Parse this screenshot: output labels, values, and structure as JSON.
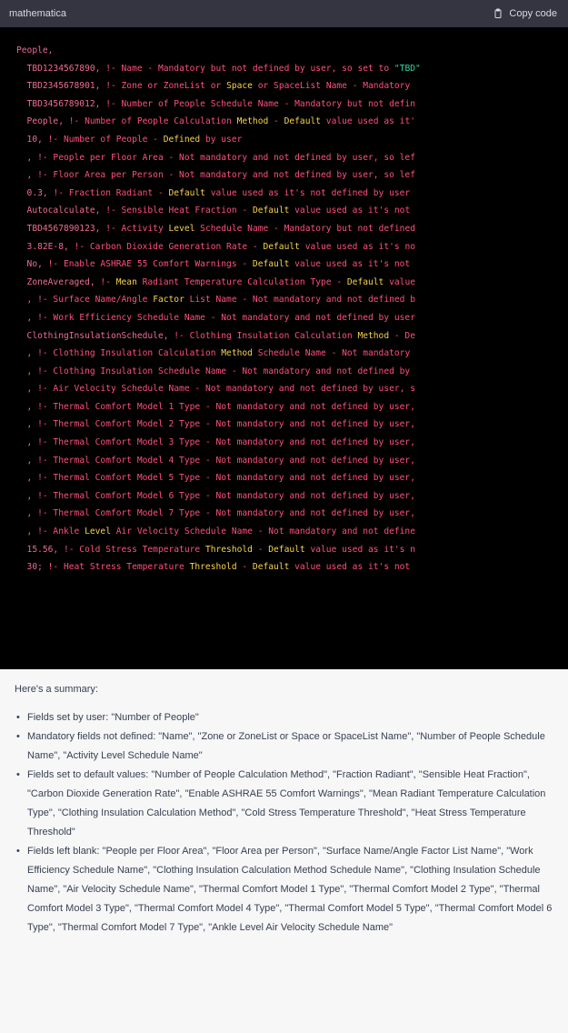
{
  "header": {
    "language": "mathematica",
    "copy_label": "Copy code"
  },
  "code_lines": [
    [
      [
        "lit",
        "People,"
      ]
    ],
    [
      [
        "lit",
        "  TBD1234567890, "
      ],
      [
        "cm",
        "!- Name - Mandatory but not defined by user, so set to "
      ],
      [
        "str",
        "\"TBD\""
      ]
    ],
    [
      [
        "lit",
        "  TBD2345678901, "
      ],
      [
        "cm",
        "!- Zone or ZoneList or "
      ],
      [
        "kw",
        "Space"
      ],
      [
        "cm",
        " or SpaceList Name - Mandatory"
      ]
    ],
    [
      [
        "lit",
        "  TBD3456789012, "
      ],
      [
        "cm",
        "!- Number of People Schedule Name - Mandatory but not defin"
      ]
    ],
    [
      [
        "lit",
        "  People, "
      ],
      [
        "cm",
        "!- Number of People Calculation "
      ],
      [
        "kw",
        "Method"
      ],
      [
        "cm",
        " - "
      ],
      [
        "kw",
        "Default"
      ],
      [
        "cm",
        " value used as it'"
      ]
    ],
    [
      [
        "lit",
        "  10, "
      ],
      [
        "cm",
        "!- Number of People - "
      ],
      [
        "kw",
        "Defined"
      ],
      [
        "cm",
        " by user"
      ]
    ],
    [
      [
        "lit",
        "  , "
      ],
      [
        "cm",
        "!- People per Floor Area - Not mandatory and not defined by user, so lef"
      ]
    ],
    [
      [
        "lit",
        "  , "
      ],
      [
        "cm",
        "!- Floor Area per Person - Not mandatory and not defined by user, so lef"
      ]
    ],
    [
      [
        "lit",
        "  0.3, "
      ],
      [
        "cm",
        "!- Fraction Radiant - "
      ],
      [
        "kw",
        "Default"
      ],
      [
        "cm",
        " value used as it's not defined by user"
      ]
    ],
    [
      [
        "lit",
        "  Autocalculate, "
      ],
      [
        "cm",
        "!- Sensible Heat Fraction - "
      ],
      [
        "kw",
        "Default"
      ],
      [
        "cm",
        " value used as it's not"
      ]
    ],
    [
      [
        "lit",
        "  TBD4567890123, "
      ],
      [
        "cm",
        "!- Activity "
      ],
      [
        "kw",
        "Level"
      ],
      [
        "cm",
        " Schedule Name - Mandatory but not defined"
      ]
    ],
    [
      [
        "lit",
        "  3.82E-8, "
      ],
      [
        "cm",
        "!- Carbon Dioxide Generation Rate - "
      ],
      [
        "kw",
        "Default"
      ],
      [
        "cm",
        " value used as it's no"
      ]
    ],
    [
      [
        "lit",
        "  No, "
      ],
      [
        "cm",
        "!- Enable ASHRAE 55 Comfort Warnings - "
      ],
      [
        "kw",
        "Default"
      ],
      [
        "cm",
        " value used as it's not"
      ]
    ],
    [
      [
        "lit",
        "  ZoneAveraged, "
      ],
      [
        "cm",
        "!- "
      ],
      [
        "kw",
        "Mean"
      ],
      [
        "cm",
        " Radiant Temperature Calculation Type - "
      ],
      [
        "kw",
        "Default"
      ],
      [
        "cm",
        " value"
      ]
    ],
    [
      [
        "lit",
        "  , "
      ],
      [
        "cm",
        "!- Surface Name/Angle "
      ],
      [
        "kw",
        "Factor"
      ],
      [
        "cm",
        " List Name - Not mandatory and not defined b"
      ]
    ],
    [
      [
        "lit",
        "  , "
      ],
      [
        "cm",
        "!- Work Efficiency Schedule Name - Not mandatory and not defined by user"
      ]
    ],
    [
      [
        "lit",
        "  ClothingInsulationSchedule, "
      ],
      [
        "cm",
        "!- Clothing Insulation Calculation "
      ],
      [
        "kw",
        "Method"
      ],
      [
        "cm",
        " - De"
      ]
    ],
    [
      [
        "lit",
        "  , "
      ],
      [
        "cm",
        "!- Clothing Insulation Calculation "
      ],
      [
        "kw",
        "Method"
      ],
      [
        "cm",
        " Schedule Name - Not mandatory"
      ]
    ],
    [
      [
        "lit",
        "  , "
      ],
      [
        "cm",
        "!- Clothing Insulation Schedule Name - Not mandatory and not defined by"
      ]
    ],
    [
      [
        "lit",
        "  , "
      ],
      [
        "cm",
        "!- Air Velocity Schedule Name - Not mandatory and not defined by user, s"
      ]
    ],
    [
      [
        "lit",
        "  , "
      ],
      [
        "cm",
        "!- Thermal Comfort Model 1 Type - Not mandatory and not defined by user,"
      ]
    ],
    [
      [
        "lit",
        "  , "
      ],
      [
        "cm",
        "!- Thermal Comfort Model 2 Type - Not mandatory and not defined by user,"
      ]
    ],
    [
      [
        "lit",
        "  , "
      ],
      [
        "cm",
        "!- Thermal Comfort Model 3 Type - Not mandatory and not defined by user,"
      ]
    ],
    [
      [
        "lit",
        "  , "
      ],
      [
        "cm",
        "!- Thermal Comfort Model 4 Type - Not mandatory and not defined by user,"
      ]
    ],
    [
      [
        "lit",
        "  , "
      ],
      [
        "cm",
        "!- Thermal Comfort Model 5 Type - Not mandatory and not defined by user,"
      ]
    ],
    [
      [
        "lit",
        "  , "
      ],
      [
        "cm",
        "!- Thermal Comfort Model 6 Type - Not mandatory and not defined by user,"
      ]
    ],
    [
      [
        "lit",
        "  , "
      ],
      [
        "cm",
        "!- Thermal Comfort Model 7 Type - Not mandatory and not defined by user,"
      ]
    ],
    [
      [
        "lit",
        "  , "
      ],
      [
        "cm",
        "!- Ankle "
      ],
      [
        "kw",
        "Level"
      ],
      [
        "cm",
        " Air Velocity Schedule Name - Not mandatory and not define"
      ]
    ],
    [
      [
        "lit",
        "  15.56, "
      ],
      [
        "cm",
        "!- Cold Stress Temperature "
      ],
      [
        "kw",
        "Threshold"
      ],
      [
        "cm",
        " - "
      ],
      [
        "kw",
        "Default"
      ],
      [
        "cm",
        " value used as it's n"
      ]
    ],
    [
      [
        "lit",
        "  30; "
      ],
      [
        "cm",
        "!- Heat Stress Temperature "
      ],
      [
        "kw",
        "Threshold"
      ],
      [
        "cm",
        " - "
      ],
      [
        "kw",
        "Default"
      ],
      [
        "cm",
        " value used as it's not"
      ]
    ]
  ],
  "summary": {
    "intro": "Here's a summary:",
    "items": [
      "Fields set by user: \"Number of People\"",
      "Mandatory fields not defined: \"Name\", \"Zone or ZoneList or Space or SpaceList Name\", \"Number of People Schedule Name\", \"Activity Level Schedule Name\"",
      "Fields set to default values: \"Number of People Calculation Method\", \"Fraction Radiant\", \"Sensible Heat Fraction\", \"Carbon Dioxide Generation Rate\", \"Enable ASHRAE 55 Comfort Warnings\", \"Mean Radiant Temperature Calculation Type\", \"Clothing Insulation Calculation Method\", \"Cold Stress Temperature Threshold\", \"Heat Stress Temperature Threshold\"",
      "Fields left blank: \"People per Floor Area\", \"Floor Area per Person\", \"Surface Name/Angle Factor List Name\", \"Work Efficiency Schedule Name\", \"Clothing Insulation Calculation Method Schedule Name\", \"Clothing Insulation Schedule Name\", \"Air Velocity Schedule Name\", \"Thermal Comfort Model 1 Type\", \"Thermal Comfort Model 2 Type\", \"Thermal Comfort Model 3 Type\", \"Thermal Comfort Model 4 Type\", \"Thermal Comfort Model 5 Type\", \"Thermal Comfort Model 6 Type\", \"Thermal Comfort Model 7 Type\", \"Ankle Level Air Velocity Schedule Name\""
    ]
  }
}
